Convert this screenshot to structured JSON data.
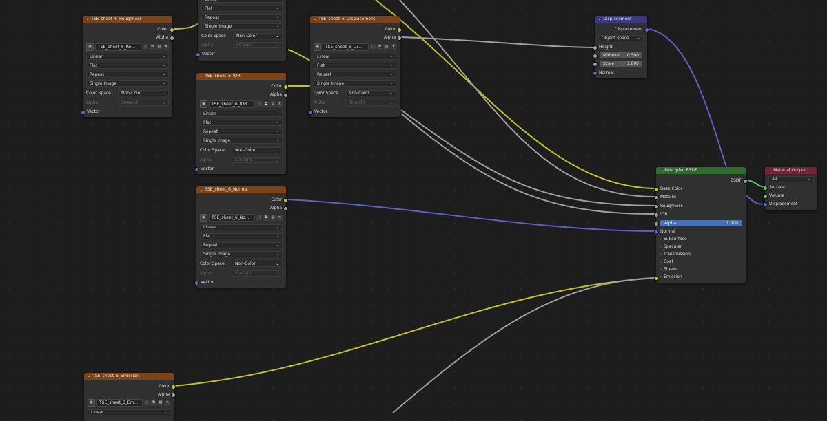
{
  "labels": {
    "color": "Color",
    "alpha": "Alpha",
    "vector": "Vector",
    "color_space": "Color Space",
    "non_color": "Non-Color",
    "straight": "Straight",
    "interpolation": "Linear",
    "projection": "Flat",
    "extension": "Repeat",
    "source": "Single Image"
  },
  "nodes": {
    "roughness": {
      "title": "TSE_sheet_6_Roughness",
      "image": "TSE_sheet_6_Ro..."
    },
    "top_partial": {
      "title": ""
    },
    "displacement_tex": {
      "title": "TSE_sheet_6_Displacement",
      "image": "TSE_sheet_6_Di..."
    },
    "ior": {
      "title": "TSE_sheet_6_IOR",
      "image": "TSE_sheet_6_IOR"
    },
    "normal": {
      "title": "TSE_sheet_6_Normal",
      "image": "TSE_sheet_6_No..."
    },
    "emission": {
      "title": "TSE_sheet_6_Emission",
      "image": "TSE_sheet_6_Em...",
      "interp": "Linear"
    },
    "displacement": {
      "title": "Displacement",
      "output": "Displacement",
      "space": "Object Space",
      "height": "Height",
      "midlevel_label": "Midlevel",
      "midlevel_value": "0.500",
      "scale_label": "Scale",
      "scale_value": "1.000",
      "normal": "Normal"
    },
    "bsdf": {
      "title": "Principled BSDF",
      "output": "BSDF",
      "inputs": [
        "Base Color",
        "Metallic",
        "Roughness",
        "IOR"
      ],
      "alpha_label": "Alpha",
      "alpha_value": "1.000",
      "normal": "Normal",
      "panels": [
        "Subsurface",
        "Specular",
        "Transmission",
        "Coat",
        "Sheen",
        "Emission"
      ]
    },
    "output": {
      "title": "Material Output",
      "target": "All",
      "inputs": [
        "Surface",
        "Volume",
        "Displacement"
      ]
    }
  },
  "colors": {
    "texture_header": "#7a4418",
    "vector_header": "#3b3686",
    "shader_header": "#2f6b2d",
    "output_header": "#6f2438",
    "color_socket": "#c7c729",
    "float_socket": "#a1a1a1",
    "vector_socket": "#6363c7",
    "shader_socket": "#63c763"
  }
}
